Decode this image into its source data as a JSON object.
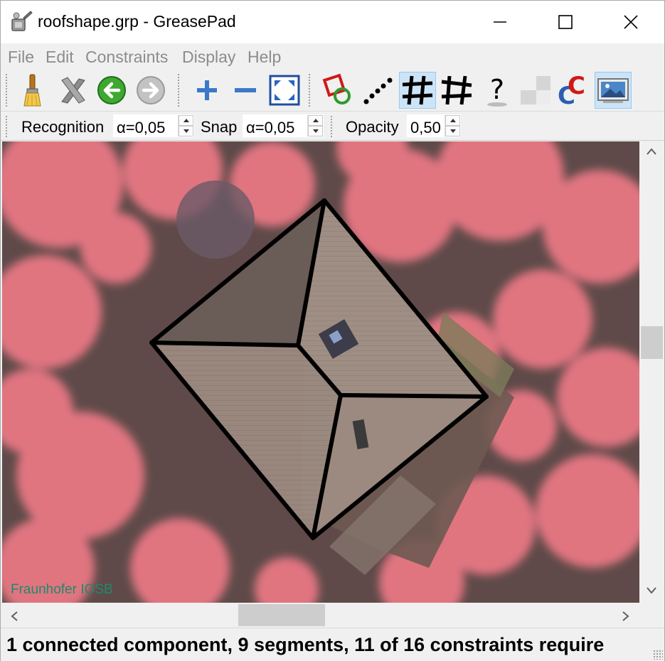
{
  "window": {
    "title": "roofshape.grp - GreasePad",
    "app_icon": "greasepad-icon",
    "controls": [
      "minimize-icon",
      "maximize-icon",
      "close-icon"
    ]
  },
  "menu": {
    "items": [
      "File",
      "Edit",
      "Constraints",
      "Display",
      "Help"
    ]
  },
  "toolbar": {
    "tools": [
      {
        "name": "brush-icon",
        "active": false
      },
      {
        "name": "delete-icon",
        "active": false
      },
      {
        "name": "undo-icon",
        "active": false
      },
      {
        "name": "redo-icon",
        "active": false
      },
      {
        "name": "zoom-in-icon",
        "active": false
      },
      {
        "name": "zoom-out-icon",
        "active": false
      },
      {
        "name": "fit-to-window-icon",
        "active": false
      },
      {
        "name": "show-constraints-icon",
        "active": false
      },
      {
        "name": "show-strokes-icon",
        "active": false
      },
      {
        "name": "show-segments-icon",
        "active": true
      },
      {
        "name": "show-unconstrained-segments-icon",
        "active": false
      },
      {
        "name": "help-icon",
        "active": false
      },
      {
        "name": "checkerboard-icon",
        "active": false
      },
      {
        "name": "colorize-icon",
        "active": false
      },
      {
        "name": "background-image-icon",
        "active": true
      }
    ]
  },
  "params": {
    "recognition_label": "Recognition",
    "recognition_value": "α=0,05",
    "snap_label": "Snap",
    "snap_value": "α=0,05",
    "opacity_label": "Opacity",
    "opacity_value": "0,50"
  },
  "canvas": {
    "watermark": "Fraunhofer IOSB"
  },
  "status": {
    "text": "1 connected component, 9 segments, 11 of 16 constraints require"
  },
  "colors": {
    "accent": "#cce4f7",
    "roof_lines": "#000000",
    "vegetation": "#e0707c",
    "watermark": "#1d8a6e"
  }
}
